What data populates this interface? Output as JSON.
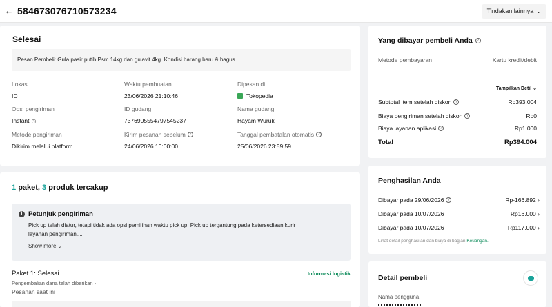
{
  "header": {
    "order_id": "584673076710573234",
    "more_actions": "Tindakan lainnya"
  },
  "order": {
    "status": "Selesai",
    "buyer_note": "Pesan Pembeli: Gula pasir putih Psm 14kg dan gulavit 4kg. Kondisi barang baru & bagus",
    "fields": {
      "location_label": "Lokasi",
      "location_value": "ID",
      "made_label": "Waktu pembuatan",
      "made_value": "23/06/2026 21:10:46",
      "ordered_on_label": "Dipesan di",
      "ordered_on_value": "Tokopedia",
      "shipping_option_label": "Opsi pengiriman",
      "shipping_option_value": "Instant",
      "warehouse_id_label": "ID gudang",
      "warehouse_id_value": "7376905554797545237",
      "warehouse_name_label": "Nama gudang",
      "warehouse_name_value": "Hayam Wuruk",
      "shipping_method_label": "Metode pengiriman",
      "shipping_method_value": "Dikirim melalui platform",
      "ship_before_label": "Kirim pesanan sebelum",
      "ship_before_value": "24/06/2026 10:00:00",
      "auto_cancel_label": "Tanggal pembatalan otomatis",
      "auto_cancel_value": "25/06/2026 23:59:59"
    }
  },
  "package": {
    "count": "1",
    "count_word": "paket,",
    "products": "3",
    "products_word": "produk tercakup",
    "instruction_title": "Petunjuk pengiriman",
    "instruction_text1": "Pick up telah diatur, tetapi tidak ada opsi pemilihan waktu pick up. Pick up tergantung pada ketersediaan kurir",
    "instruction_text2": "layanan pengiriman....",
    "show_more": "Show more",
    "package_label": "Paket 1:",
    "package_status": "Selesai",
    "logistics_link": "Informasi logistik",
    "refund_text": "Pengembalian dana telah diberikan",
    "current_order": "Pesanan saat ini"
  },
  "payment": {
    "title": "Yang dibayar pembeli Anda",
    "method_label": "Metode pembayaran",
    "method_value": "Kartu kredit/debit",
    "show_detail": "Tampilkan Detil",
    "subtotal_label": "Subtotal item setelah diskon",
    "subtotal_value": "Rp393.004",
    "shipping_label": "Biaya pengiriman setelah diskon",
    "shipping_value": "Rp0",
    "service_label": "Biaya layanan aplikasi",
    "service_value": "Rp1.000",
    "total_label": "Total",
    "total_value": "Rp394.004"
  },
  "income": {
    "title": "Penghasilan Anda",
    "rows": [
      {
        "label": "Dibayar pada 29/06/2026",
        "value": "Rp-166.892"
      },
      {
        "label": "Dibayar pada 10/07/2026",
        "value": "Rp16.000"
      },
      {
        "label": "Dibayar pada 10/07/2026",
        "value": "Rp117.000"
      }
    ],
    "footnote": "Lihat detail penghasilan dan biaya di bagian",
    "footnote_link": "Keuangan."
  },
  "buyer": {
    "title": "Detail pembeli",
    "username_label": "Nama pengguna"
  }
}
